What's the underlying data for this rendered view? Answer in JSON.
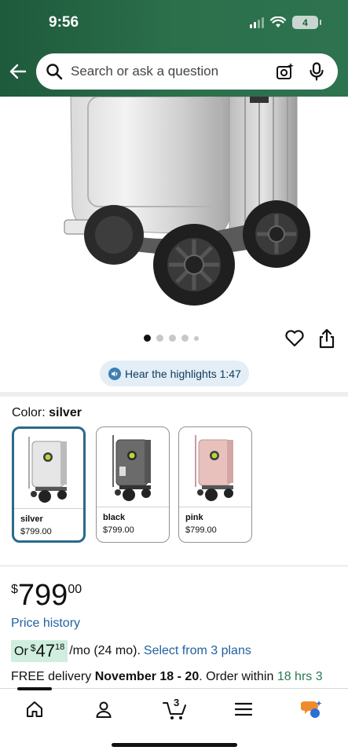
{
  "status": {
    "time": "9:56",
    "battery": "4"
  },
  "search": {
    "placeholder": "Search or ask a question"
  },
  "hear": {
    "label": "Hear the highlights 1:47"
  },
  "color": {
    "label": "Color: ",
    "selected": "silver"
  },
  "swatches": [
    {
      "name": "silver",
      "price": "$799.00",
      "selected": true
    },
    {
      "name": "black",
      "price": "$799.00",
      "selected": false
    },
    {
      "name": "pink",
      "price": "$799.00",
      "selected": false
    }
  ],
  "price": {
    "symbol": "$",
    "dollars": "799",
    "cents": "00"
  },
  "price_history": "Price history",
  "monthly": {
    "prefix": "Or ",
    "symbol": "$",
    "amount": "47",
    "cents": "18",
    "suffix": "/mo (24 mo).",
    "link": "Select from 3 plans"
  },
  "delivery": {
    "prefix": "FREE delivery ",
    "dates": "November 18 - 20",
    "middle": ". Order within ",
    "time": "18 hrs 3"
  },
  "nav": {
    "cart_count": "3"
  },
  "carousel": {
    "total": 5,
    "active": 0
  },
  "colors": {
    "header": "#2b6f4b",
    "link": "#2162a1",
    "selected_border": "#2a6a8a"
  }
}
